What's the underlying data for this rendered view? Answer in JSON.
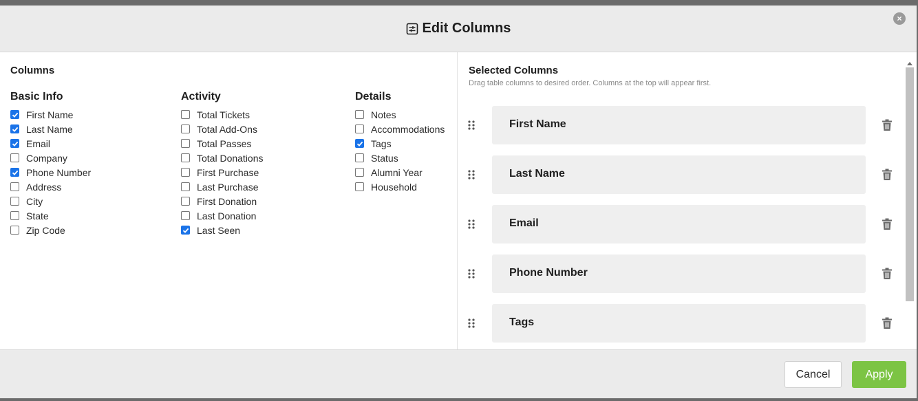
{
  "modal": {
    "title": "Edit Columns",
    "title_icon": "columns-settings-icon",
    "close_icon": "close-icon"
  },
  "columns": {
    "heading": "Columns",
    "groups": [
      {
        "title": "Basic Info",
        "options": [
          {
            "label": "First Name",
            "checked": true
          },
          {
            "label": "Last Name",
            "checked": true
          },
          {
            "label": "Email",
            "checked": true
          },
          {
            "label": "Company",
            "checked": false
          },
          {
            "label": "Phone Number",
            "checked": true
          },
          {
            "label": "Address",
            "checked": false
          },
          {
            "label": "City",
            "checked": false
          },
          {
            "label": "State",
            "checked": false
          },
          {
            "label": "Zip Code",
            "checked": false
          }
        ]
      },
      {
        "title": "Activity",
        "options": [
          {
            "label": "Total Tickets",
            "checked": false
          },
          {
            "label": "Total Add-Ons",
            "checked": false
          },
          {
            "label": "Total Passes",
            "checked": false
          },
          {
            "label": "Total Donations",
            "checked": false
          },
          {
            "label": "First Purchase",
            "checked": false
          },
          {
            "label": "Last Purchase",
            "checked": false
          },
          {
            "label": "First Donation",
            "checked": false
          },
          {
            "label": "Last Donation",
            "checked": false
          },
          {
            "label": "Last Seen",
            "checked": true
          }
        ]
      },
      {
        "title": "Details",
        "options": [
          {
            "label": "Notes",
            "checked": false
          },
          {
            "label": "Accommodations",
            "checked": false
          },
          {
            "label": "Tags",
            "checked": true
          },
          {
            "label": "Status",
            "checked": false
          },
          {
            "label": "Alumni Year",
            "checked": false
          },
          {
            "label": "Household",
            "checked": false
          }
        ]
      }
    ]
  },
  "selected": {
    "heading": "Selected Columns",
    "hint": "Drag table columns to desired order. Columns at the top will appear first.",
    "items": [
      "First Name",
      "Last Name",
      "Email",
      "Phone Number",
      "Tags"
    ]
  },
  "footer": {
    "cancel_label": "Cancel",
    "apply_label": "Apply"
  },
  "colors": {
    "apply": "#7cc444",
    "checkbox": "#1a73e8",
    "header_bg": "#ebebeb"
  }
}
